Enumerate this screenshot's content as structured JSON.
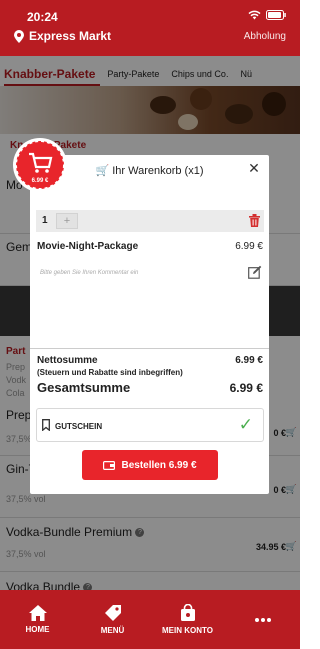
{
  "status": {
    "time": "20:24"
  },
  "header": {
    "store": "Express Markt",
    "mode": "Abholung"
  },
  "tabs": [
    {
      "label": "Knabber-Pakete",
      "active": true
    },
    {
      "label": "Party-Pakete"
    },
    {
      "label": "Chips und Co."
    },
    {
      "label": "Nü"
    }
  ],
  "background_list": {
    "section_title": "Knabber-Pakete",
    "rows": [
      {
        "name": "Mo",
        "price": "",
        "sub": ""
      },
      {
        "name": "Gem",
        "price": "",
        "sub": ""
      },
      {
        "name": "Part",
        "sub1": "Prep",
        "sub2": "Vodk",
        "sub3": "Cola"
      },
      {
        "name": "Prepa",
        "sub": "37,5%",
        "price": "0 €"
      },
      {
        "name": "Gin-T",
        "sub": "37,5% vol",
        "price": "0 €"
      },
      {
        "name": "Vodka-Bundle Premium",
        "sub": "37,5% vol",
        "price": "34.95 €"
      },
      {
        "name": "Vodka Bundle",
        "sub": "",
        "price": ""
      }
    ]
  },
  "cart_modal": {
    "title": "Ihr Warenkorb (x1)",
    "seal_price": "6.99 €",
    "quantity": "1",
    "plus_label": "+",
    "item_name": "Movie-Night-Package",
    "item_price": "6.99 €",
    "comment_placeholder": "Bitte geben Sie Ihren Kommentar ein",
    "net_label": "Nettosumme",
    "net_value": "6.99 €",
    "tax_note": "(Steuern und Rabatte sind inbegriffen)",
    "total_label": "Gesamtsumme",
    "total_value": "6.99 €",
    "voucher_label": "GUTSCHEIN",
    "order_button": "Bestellen 6.99 €"
  },
  "bottom_nav": [
    {
      "label": "HOME",
      "icon": "home-icon"
    },
    {
      "label": "MENÜ",
      "icon": "tag-icon"
    },
    {
      "label": "MEIN KONTO",
      "icon": "bag-icon"
    },
    {
      "label": "",
      "icon": "more-icon"
    }
  ],
  "colors": {
    "brand": "#b81c22",
    "button": "#e8252b",
    "check": "#4caf50"
  }
}
